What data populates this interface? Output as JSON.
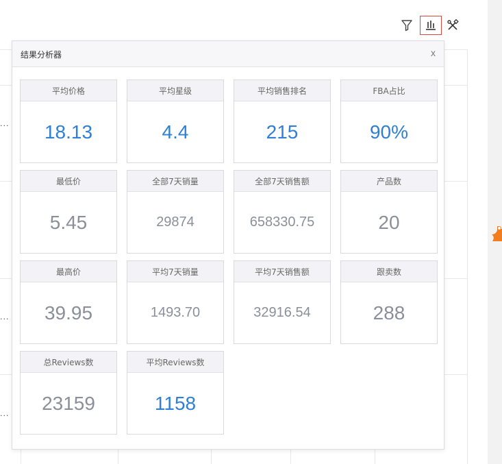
{
  "toolbar": {
    "filter_icon": "filter-icon",
    "chart_icon": "bar-chart-icon",
    "tools_icon": "tools-icon"
  },
  "panel": {
    "title": "结果分析器",
    "close_label": "x"
  },
  "background": {
    "ellipsis": "..."
  },
  "colors": {
    "accent_blue": "#2f7fd6",
    "muted_value": "#8a8f99",
    "active_border": "#e0443e",
    "flag_orange": "#f27d1e"
  },
  "stats": [
    {
      "label": "平均价格",
      "value": "18.13",
      "highlight": true
    },
    {
      "label": "平均星级",
      "value": "4.4",
      "highlight": true
    },
    {
      "label": "平均销售排名",
      "value": "215",
      "highlight": true
    },
    {
      "label": "FBA占比",
      "value": "90%",
      "highlight": true
    },
    {
      "label": "最低价",
      "value": "5.45",
      "highlight": false
    },
    {
      "label": "全部7天销量",
      "value": "29874",
      "highlight": false
    },
    {
      "label": "全部7天销售额",
      "value": "658330.75",
      "highlight": false
    },
    {
      "label": "产品数",
      "value": "20",
      "highlight": false
    },
    {
      "label": "最高价",
      "value": "39.95",
      "highlight": false
    },
    {
      "label": "平均7天销量",
      "value": "1493.70",
      "highlight": false
    },
    {
      "label": "平均7天销售额",
      "value": "32916.54",
      "highlight": false
    },
    {
      "label": "跟卖数",
      "value": "288",
      "highlight": false
    },
    {
      "label": "总Reviews数",
      "value": "23159",
      "highlight": false
    },
    {
      "label": "平均Reviews数",
      "value": "1158",
      "highlight": true
    }
  ]
}
